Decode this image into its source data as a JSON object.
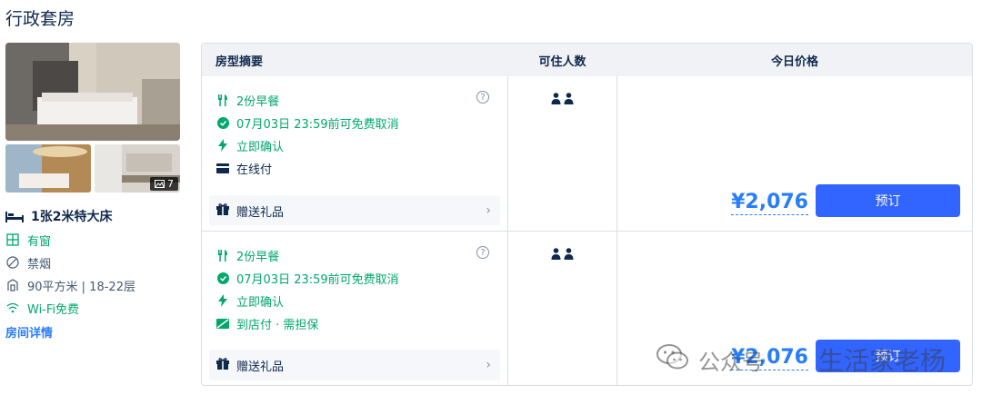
{
  "room": {
    "title": "行政套房",
    "photo_count": "7",
    "bed": "1张2米特大床",
    "features": [
      {
        "icon": "window-icon",
        "label": "有窗"
      },
      {
        "icon": "no-smoking-icon",
        "label": "禁烟"
      },
      {
        "icon": "area-icon",
        "label": "90平方米 | 18-22层"
      },
      {
        "icon": "wifi-icon",
        "label": "Wi-Fi免费"
      }
    ],
    "detail_link": "房间详情"
  },
  "table": {
    "headers": [
      "房型摘要",
      "可住人数",
      "今日价格"
    ]
  },
  "rates": [
    {
      "breakfast": "2份早餐",
      "cancel": "07月03日 23:59前可免费取消",
      "confirm": "立即确认",
      "payment": "在线付",
      "gift": "赠送礼品",
      "price": "¥2,076",
      "book": "预订"
    },
    {
      "breakfast": "2份早餐",
      "cancel": "07月03日 23:59前可免费取消",
      "confirm": "立即确认",
      "payment": "到店付 · 需担保",
      "gift": "赠送礼品",
      "price": "¥2,076",
      "book": "预订"
    }
  ],
  "watermark": {
    "left": "公众号",
    "right": "生活家老杨"
  },
  "colors": {
    "accent": "#287dfa",
    "button": "#3264ff",
    "green": "#00a86b"
  }
}
